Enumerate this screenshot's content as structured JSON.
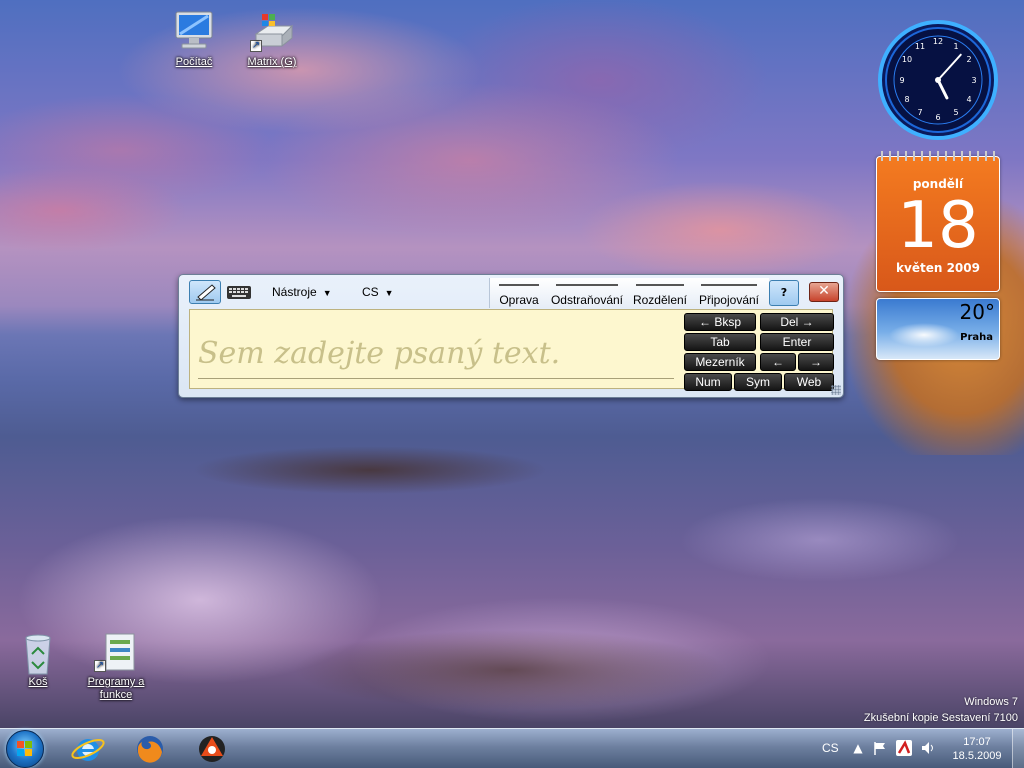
{
  "desktop": {
    "icons": [
      {
        "label": "Počítač",
        "icon": "computer-icon"
      },
      {
        "label": "Matrix (G)",
        "icon": "drive-shortcut-icon"
      },
      {
        "label": "Koš",
        "icon": "recycle-bin-icon"
      },
      {
        "label": "Programy a funkce",
        "icon": "programs-features-icon"
      }
    ]
  },
  "gadgets": {
    "clock": {
      "time": "17:07",
      "hour": 17,
      "minute": 7
    },
    "calendar": {
      "day_name": "pondělí",
      "date": "18",
      "month_year": "květen 2009"
    },
    "weather": {
      "temperature": "20°",
      "city": "Praha"
    }
  },
  "input_panel": {
    "tools_label": "Nástroje",
    "language_label": "CS",
    "gestures": [
      "Oprava",
      "Odstraňování",
      "Rozdělení",
      "Připojování"
    ],
    "placeholder": "Sem zadejte psaný text.",
    "keys": {
      "bksp": "← Bksp",
      "del": "Del →",
      "tab": "Tab",
      "enter": "Enter",
      "space": "Mezerník",
      "left": "←",
      "right": "→",
      "num": "Num",
      "sym": "Sym",
      "web": "Web"
    },
    "colors": {
      "writing_bg": "#fdf7cf",
      "close_button": "#c7432c"
    }
  },
  "watermark": {
    "line1": "Windows 7",
    "line2": "Zkušební kopie Sestavení 7100"
  },
  "taskbar": {
    "pinned": [
      "internet-explorer-icon",
      "firefox-icon",
      "reason-app-icon"
    ],
    "tray": {
      "language": "CS",
      "time": "17:07",
      "date": "18.5.2009",
      "icons": [
        "show-hidden-icon",
        "action-center-flag-icon",
        "antivirus-icon",
        "volume-icon"
      ]
    }
  }
}
